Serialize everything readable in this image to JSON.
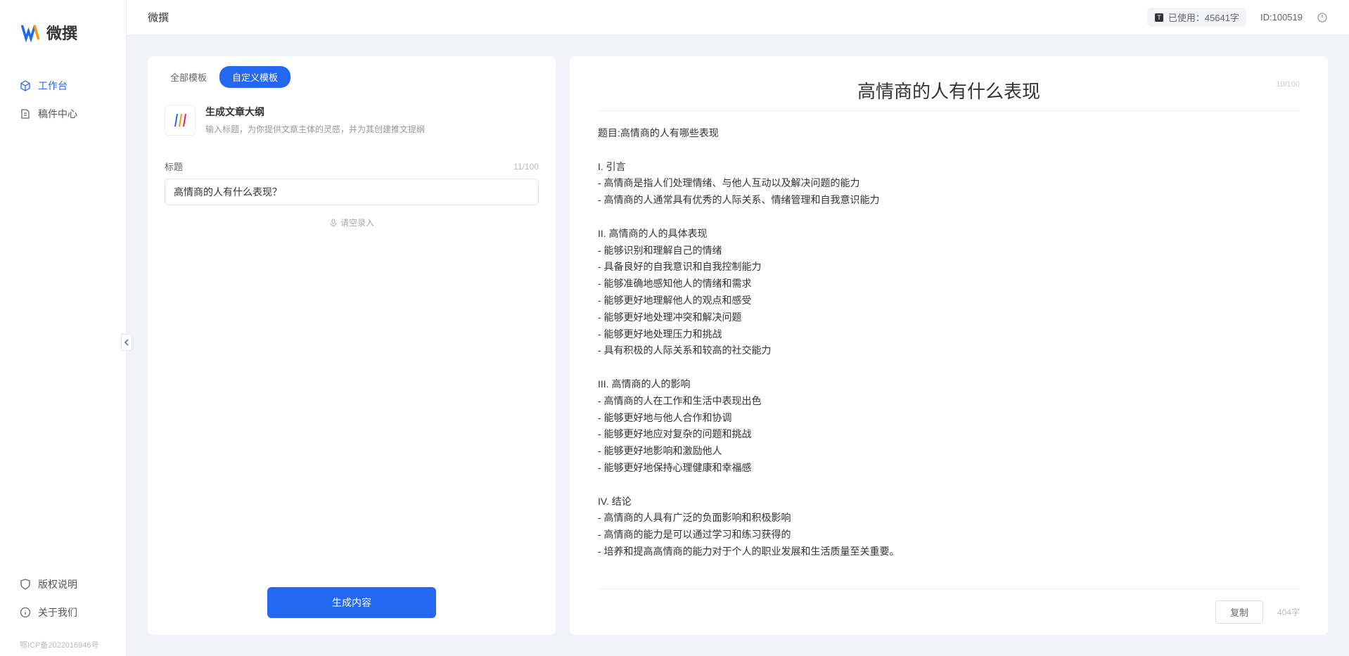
{
  "brand": "微撰",
  "topbar": {
    "title": "微撰",
    "usage_label": "已使用：45641字",
    "id_label": "ID:100519"
  },
  "sidebar": {
    "items": [
      {
        "label": "工作台",
        "active": true
      },
      {
        "label": "稿件中心",
        "active": false
      }
    ],
    "bottom": [
      {
        "label": "版权说明"
      },
      {
        "label": "关于我们"
      }
    ],
    "icp": "鄂ICP备2022016946号"
  },
  "left_panel": {
    "tabs": [
      {
        "label": "全部模板",
        "active": false
      },
      {
        "label": "自定义模板",
        "active": true
      }
    ],
    "template": {
      "title": "生成文章大纲",
      "desc": "输入标题，为你提供文章主体的灵感，并为其创建推文提纲"
    },
    "form": {
      "title_label": "标题",
      "title_count": "11/100",
      "title_value": "高情商的人有什么表现？",
      "voice_hint": "请空录入"
    },
    "generate_label": "生成内容"
  },
  "right_panel": {
    "title": "高情商的人有什么表现",
    "header_count": "10/100",
    "body": "题目:高情商的人有哪些表现\n\nI. 引言\n- 高情商是指人们处理情绪、与他人互动以及解决问题的能力\n- 高情商的人通常具有优秀的人际关系、情绪管理和自我意识能力\n\nII. 高情商的人的具体表现\n- 能够识别和理解自己的情绪\n- 具备良好的自我意识和自我控制能力\n- 能够准确地感知他人的情绪和需求\n- 能够更好地理解他人的观点和感受\n- 能够更好地处理冲突和解决问题\n- 能够更好地处理压力和挑战\n- 具有积极的人际关系和较高的社交能力\n\nIII. 高情商的人的影响\n- 高情商的人在工作和生活中表现出色\n- 能够更好地与他人合作和协调\n- 能够更好地应对复杂的问题和挑战\n- 能够更好地影响和激励他人\n- 能够更好地保持心理健康和幸福感\n\nIV. 结论\n- 高情商的人具有广泛的负面影响和积极影响\n- 高情商的能力是可以通过学习和练习获得的\n- 培养和提高高情商的能力对于个人的职业发展和生活质量至关重要。",
    "copy_label": "复制",
    "word_count": "404字"
  }
}
